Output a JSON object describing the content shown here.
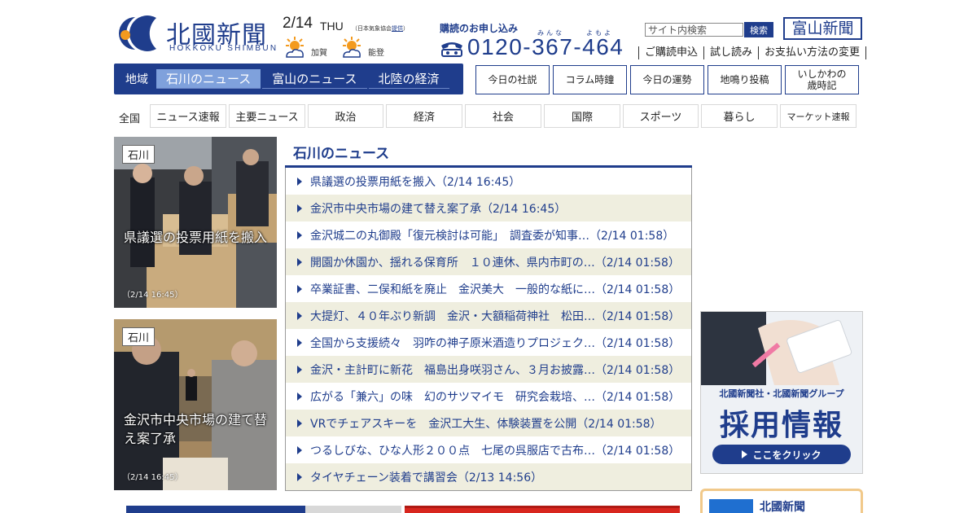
{
  "header": {
    "logo_jp": "北國新聞",
    "logo_en": "HOKKOKU SHIMBUN",
    "date": "2/14",
    "weekday": "THU",
    "weather_note_prefix": "（日本気象協会",
    "weather_note_link": "提供",
    "weather_note_suffix": "）",
    "weather": [
      {
        "area": "加賀",
        "icon": "sunny-cloud-icon"
      },
      {
        "area": "能登",
        "icon": "sunny-cloud-icon"
      }
    ],
    "subscription_title": "購読のお申し込み",
    "ruby_1": "みんな",
    "ruby_2": "よもよ",
    "phone": "0120-367-464",
    "search_placeholder": "サイト内検索",
    "search_button": "検索",
    "toyama_logo": "富山新聞",
    "links": [
      "ご購読申込",
      "試し読み",
      "お支払い方法の変更"
    ]
  },
  "region_nav": {
    "label": "地域",
    "tabs": [
      {
        "label": "石川のニュース",
        "active": true
      },
      {
        "label": "富山のニュース",
        "active": false
      },
      {
        "label": "北陸の経済",
        "active": false
      }
    ]
  },
  "column_nav": [
    "今日の社説",
    "コラム時鐘",
    "今日の運勢",
    "地鳴り投稿",
    "いしかわの\n歳時記"
  ],
  "category_nav": {
    "label": "全国",
    "items": [
      "ニュース速報",
      "主要ニュース",
      "政治",
      "経済",
      "社会",
      "国際",
      "スポーツ",
      "暮らし",
      "マーケット速報"
    ]
  },
  "photos": [
    {
      "tag": "石川",
      "caption": "県議選の投票用紙を搬入",
      "time": "（2/14 16:45）"
    },
    {
      "tag": "石川",
      "caption": "金沢市中央市場の建て替え案了承",
      "time": "（2/14 16:45）"
    }
  ],
  "news": {
    "title": "石川のニュース",
    "items": [
      "県議選の投票用紙を搬入（2/14 16:45）",
      "金沢市中央市場の建て替え案了承（2/14 16:45）",
      "金沢城二の丸御殿「復元検討は可能」　調査委が知事…（2/14 01:58）",
      "開園か休園か、揺れる保育所　１０連休、県内市町の…（2/14 01:58）",
      "卒業証書、二俣和紙を廃止　金沢美大　一般的な紙に…（2/14 01:58）",
      "大提灯、４０年ぶり新調　金沢・大額稲荷神社　松田…（2/14 01:58）",
      "全国から支援続々　羽咋の神子原米酒造りプロジェク…（2/14 01:58）",
      "金沢・主計町に新花　福島出身咲羽さん、３月お披露…（2/14 01:58）",
      "広がる「兼六」の味　幻のサツマイモ　研究会栽培、…（2/14 01:58）",
      "VRでチェアスキーを　金沢工大生、体験装置を公開（2/14 01:58）",
      "つるしびな、ひな人形２００点　七尾の呉服店で古布…（2/14 01:58）",
      "タイヤチェーン装着で講習会（2/13 14:56）"
    ]
  },
  "recruit": {
    "sub": "北國新聞社・北國新聞グループ",
    "main": "採用情報",
    "button": "ここをクリック"
  },
  "sns": {
    "name": "北國新聞"
  },
  "colors": {
    "brand": "#1f3d8c",
    "active_tab": "#7fa1dc",
    "row_alt": "#efeedf",
    "orange": "#f39a1e"
  }
}
